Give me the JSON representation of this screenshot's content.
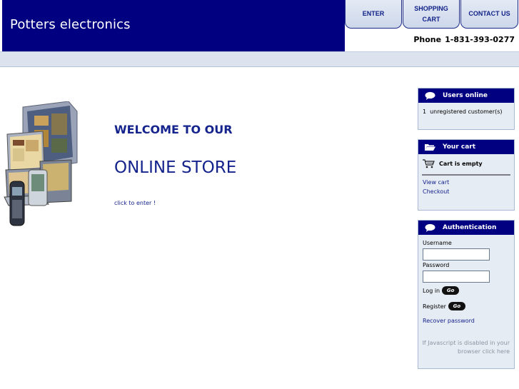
{
  "header": {
    "brand": "Potters electronics",
    "nav": [
      {
        "label": "ENTER"
      },
      {
        "label": "SHOPPING CART"
      },
      {
        "label": "CONTACT US"
      }
    ],
    "phone_label": "Phone",
    "phone_number": "1-831-393-0277"
  },
  "main": {
    "welcome": "WELCOME TO OUR",
    "store": "ONLINE STORE",
    "enter_link": "click to enter !"
  },
  "sidebar": {
    "users_online": {
      "title": "Users online",
      "count": "1",
      "text": "unregistered customer(s)"
    },
    "cart": {
      "title": "Your cart",
      "status": "Cart is empty",
      "view_cart": "View cart",
      "checkout": "Checkout"
    },
    "auth": {
      "title": "Authentication",
      "username_label": "Username",
      "password_label": "Password",
      "login_label": "Log in",
      "register_label": "Register",
      "go_label": "Go",
      "recover": "Recover password",
      "js_note": "If Javascript is disabled in your browser click here"
    }
  },
  "colors": {
    "brand_blue": "#000080",
    "link_blue": "#15238c",
    "sidebar_bg": "#e6ecf3",
    "bar_bg": "#dde3ee"
  },
  "icons": {
    "users_online": "speech-bubble-icon",
    "cart_title": "folder-icon",
    "cart_status": "shopping-cart-icon",
    "auth": "speech-bubble-icon"
  }
}
